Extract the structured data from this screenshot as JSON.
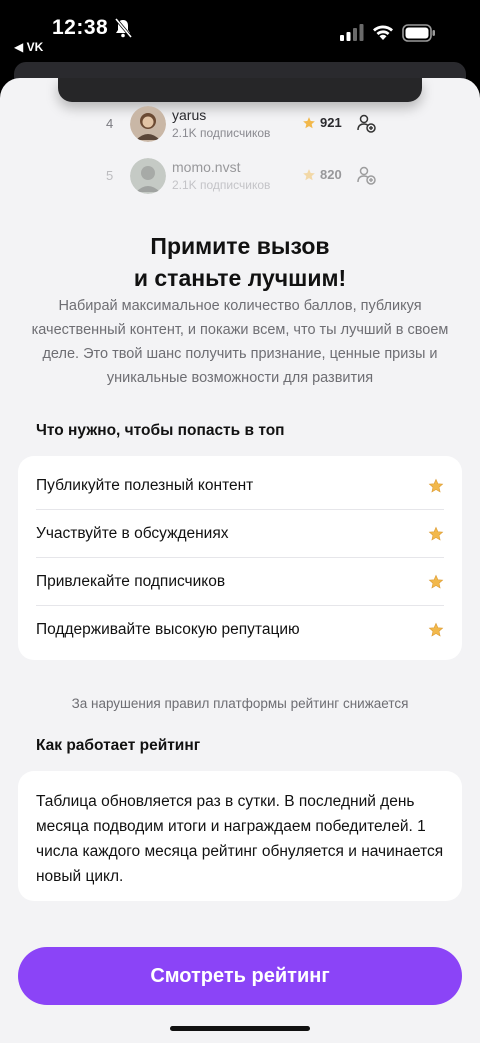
{
  "status_bar": {
    "time": "12:38",
    "back_app": "◀ VK"
  },
  "leaderboard": [
    {
      "rank": "4",
      "name": "yarus",
      "subscribers": "2.1K подписчиков",
      "score": "921"
    },
    {
      "rank": "5",
      "name": "momo.nvst",
      "subscribers": "2.1K подписчиков",
      "score": "820"
    }
  ],
  "headline": {
    "line1": "Примите вызов",
    "line2": "и станьте лучшим!"
  },
  "description": "Набирай максимальное количество баллов, публикуя качественный контент, и покажи всем, что ты лучший в своем деле. Это твой шанс получить признание, ценные призы и уникальные возможности для развития",
  "requirements": {
    "title": "Что нужно, чтобы попасть в топ",
    "items": [
      "Публикуйте полезный контент",
      "Участвуйте в обсуждениях",
      "Привлекайте подписчиков",
      "Поддерживайте высокую репутацию"
    ]
  },
  "rules_note": "За нарушения правил платформы рейтинг снижается",
  "rating_info": {
    "title": "Как работает рейтинг",
    "text": "Таблица обновляется раз в сутки. В последний день месяца подводим итоги и награждаем победителей. 1 числа каждого месяца рейтинг обнуляется и начинается новый цикл."
  },
  "cta_label": "Смотреть рейтинг",
  "colors": {
    "accent": "#8b44f7",
    "star": "#f2b84b",
    "background": "#f3f3f5"
  }
}
